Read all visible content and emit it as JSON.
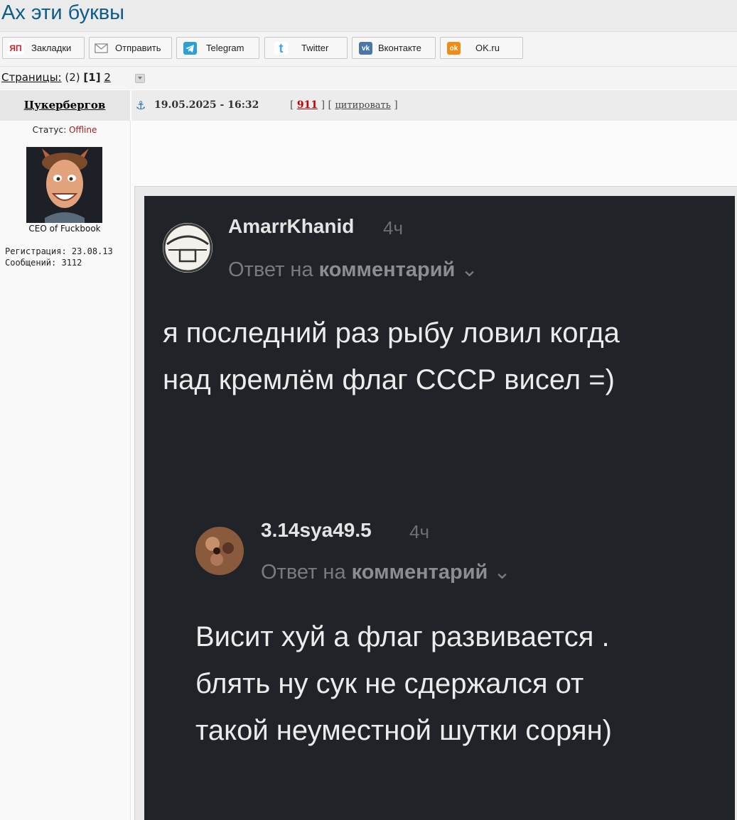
{
  "page_title": "Ах эти буквы",
  "share_bar": {
    "buttons": [
      {
        "label": "Закладки",
        "icon": "yandex-bookmarks-icon",
        "icon_text": "ЯП",
        "color": "#d9202a"
      },
      {
        "label": "Отправить",
        "icon": "envelope-icon",
        "icon_text": "",
        "color": "#7a7a7a"
      },
      {
        "label": "Telegram",
        "icon": "telegram-icon",
        "icon_text": "",
        "color": "#2b9fd6"
      },
      {
        "label": "Twitter",
        "icon": "twitter-icon",
        "icon_text": "t",
        "color": "#3fa6e6"
      },
      {
        "label": "Вконтакте",
        "icon": "vk-icon",
        "icon_text": "vk",
        "color": "#4a76a8"
      },
      {
        "label": "OK.ru",
        "icon": "odnoklassniki-icon",
        "icon_text": "ok",
        "color": "#f28a14"
      }
    ]
  },
  "pagination": {
    "label": "Страницы:",
    "total": "(2)",
    "current": "[1]",
    "next": "2"
  },
  "post": {
    "author": "Цукербергов",
    "date": "19.05.2025 - 16:32",
    "number": "911",
    "quote_label": "цитировать",
    "meta_open": "[",
    "meta_mid": "] [",
    "meta_close": "]"
  },
  "user": {
    "status_label": "Статус:",
    "status_value": "Offline",
    "title": "CEO of Fuckbook",
    "registration": "Регистрация: 23.08.13",
    "messages": "Сообщений: 3112"
  },
  "screenshot": {
    "comments": [
      {
        "username": "AmarrKhanid",
        "time": "4ч",
        "reply_prefix": "Ответ на",
        "reply_target": "комментарий",
        "text_lines": [
          "я последний раз рыбу ловил когда",
          "над кремлём флаг СССР висел =)"
        ]
      },
      {
        "username": "3.14sya49.5",
        "time": "4ч",
        "reply_prefix": "Ответ на",
        "reply_target": "комментарий",
        "text_lines": [
          "Висит хуй а флаг развивается .",
          "блять ну сук не сдержался от",
          "такой неуместной шутки сорян)"
        ]
      }
    ]
  },
  "colors": {
    "title": "#0d5c8a",
    "dark_background": "#202327",
    "offline": "#9b1c1c",
    "post_number": "#c40000"
  }
}
